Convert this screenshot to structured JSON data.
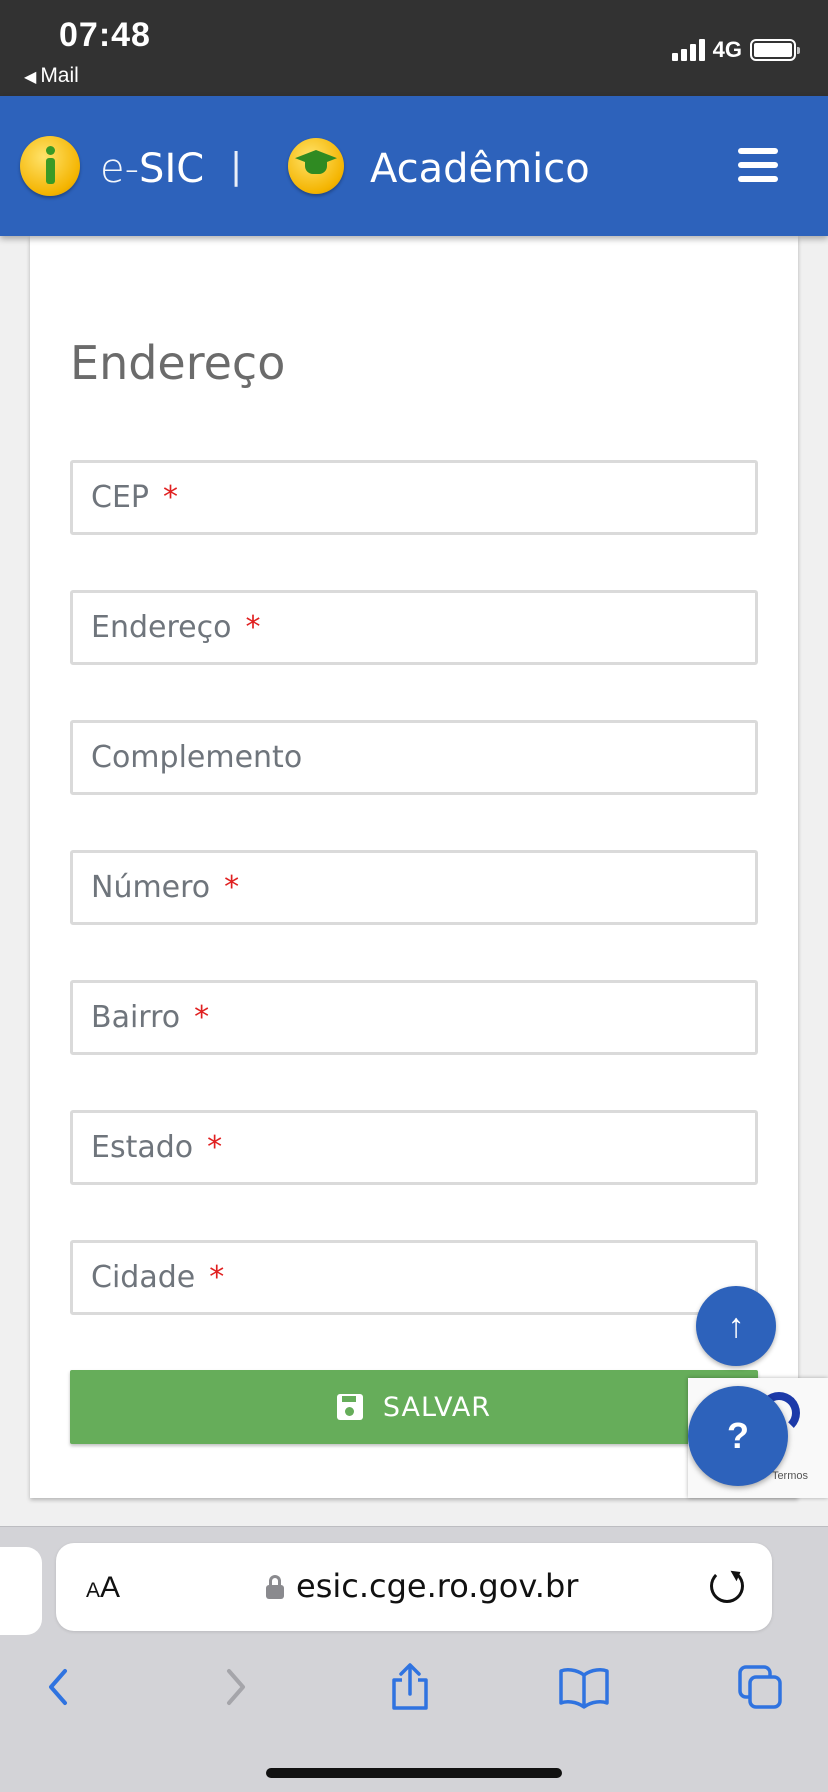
{
  "status_bar": {
    "time": "07:48",
    "back_label": "Mail",
    "network": "4G"
  },
  "header": {
    "brand_prefix": "e-",
    "brand_name": "SIC",
    "separator": "|",
    "title": "Acadêmico"
  },
  "form": {
    "section_title": "Endereço",
    "fields": [
      {
        "placeholder": "CEP",
        "required_mark": "*"
      },
      {
        "placeholder": "Endereço",
        "required_mark": "*"
      },
      {
        "placeholder": "Complemento",
        "required_mark": ""
      },
      {
        "placeholder": "Número",
        "required_mark": "*"
      },
      {
        "placeholder": "Bairro",
        "required_mark": "*"
      },
      {
        "placeholder": "Estado",
        "required_mark": "*"
      },
      {
        "placeholder": "Cidade",
        "required_mark": "*"
      }
    ],
    "save_label": "SALVAR"
  },
  "floating": {
    "scroll_top_glyph": "↑",
    "help_glyph": "?",
    "recaptcha_terms": "Termos"
  },
  "browser": {
    "text_size_label_small": "A",
    "text_size_label_large": "A",
    "url": "esic.cge.ro.gov.br"
  },
  "colors": {
    "header_blue": "#2d62bb",
    "save_green": "#66ad5a",
    "required_red": "#e02020"
  }
}
